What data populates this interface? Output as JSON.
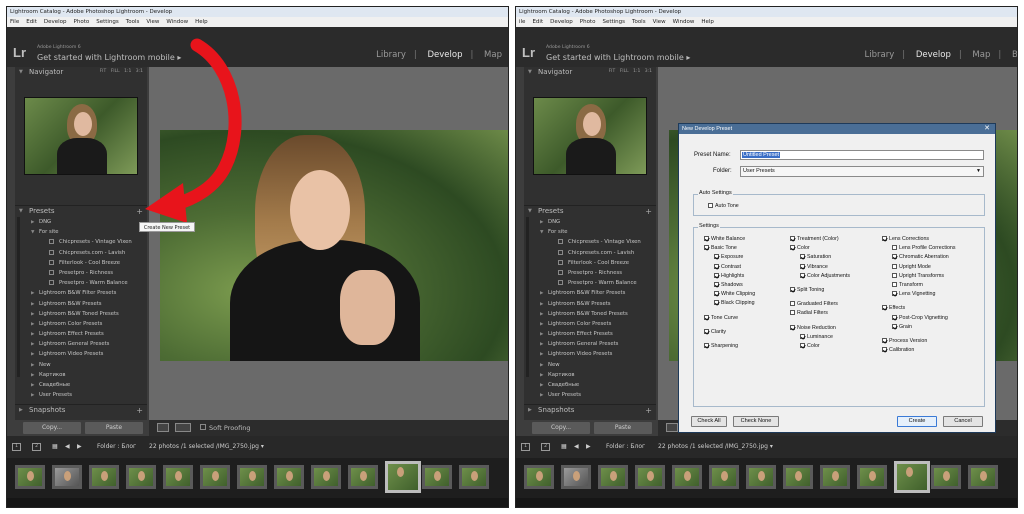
{
  "window": {
    "title": "Lightroom Catalog - Adobe Photoshop Lightroom - Develop",
    "menu": [
      "File",
      "Edit",
      "Develop",
      "Photo",
      "Settings",
      "Tools",
      "View",
      "Window",
      "Help"
    ],
    "menu_right": [
      "ile",
      "Edit",
      "Develop",
      "Photo",
      "Settings",
      "Tools",
      "View",
      "Window",
      "Help"
    ]
  },
  "topbar": {
    "logo": "Lr",
    "version": "Adobe Lightroom 6",
    "mobile": "Get started with Lightroom mobile ▸",
    "modules_left": [
      "Library",
      "Develop",
      "Map"
    ],
    "modules_right": [
      "Library",
      "Develop",
      "Map",
      "Bo"
    ]
  },
  "navigator": {
    "title": "Navigator",
    "options": [
      "FIT",
      "FILL",
      "1:1",
      "3:1"
    ]
  },
  "presets": {
    "title": "Presets",
    "items": [
      {
        "label": "DNG",
        "level": 0,
        "arrow": "▶"
      },
      {
        "label": "For site",
        "level": 0,
        "arrow": "▼"
      },
      {
        "label": "Chicpresets - Vintage Vixen",
        "level": 2
      },
      {
        "label": "Chicpresets.com - Lavish",
        "level": 2
      },
      {
        "label": "Filterlook - Cool Breeze",
        "level": 2
      },
      {
        "label": "Presetpro - Richness",
        "level": 2
      },
      {
        "label": "Presetpro - Warm Balance",
        "level": 2
      },
      {
        "label": "Lightroom B&W Filter Presets",
        "level": 0,
        "arrow": "▶"
      },
      {
        "label": "Lightroom B&W Presets",
        "level": 0,
        "arrow": "▶"
      },
      {
        "label": "Lightroom B&W Toned Presets",
        "level": 0,
        "arrow": "▶"
      },
      {
        "label": "Lightroom Color Presets",
        "level": 0,
        "arrow": "▶"
      },
      {
        "label": "Lightroom Effect Presets",
        "level": 0,
        "arrow": "▶"
      },
      {
        "label": "Lightroom General Presets",
        "level": 0,
        "arrow": "▶"
      },
      {
        "label": "Lightroom Video Presets",
        "level": 0,
        "arrow": "▶"
      },
      {
        "label": "New",
        "level": 0,
        "arrow": "▶"
      },
      {
        "label": "Картиков",
        "level": 0,
        "arrow": "▶"
      },
      {
        "label": "Свадебные",
        "level": 0,
        "arrow": "▶"
      },
      {
        "label": "User Presets",
        "level": 0,
        "arrow": "▶"
      }
    ]
  },
  "snapshots": {
    "title": "Snapshots"
  },
  "buttons": {
    "copy": "Copy...",
    "paste": "Paste"
  },
  "toolstrip": {
    "soft_proofing": "Soft Proofing"
  },
  "filmbar": {
    "screen1": "1",
    "screen2": "2",
    "folder": "Folder : Блог",
    "photos": "22 photos /1 selected /IMG_2750.jpg ▾"
  },
  "tooltip": "Create New Preset",
  "dialog": {
    "title": "New Develop Preset",
    "close": "✕",
    "preset_name_label": "Preset Name:",
    "preset_name_value": "Untitled Preset",
    "folder_label": "Folder:",
    "folder_value": "User Presets",
    "auto_settings_label": "Auto Settings",
    "auto_tone": "Auto Tone",
    "settings_label": "Settings",
    "col1": [
      {
        "label": "White Balance",
        "on": true,
        "indent": 0
      },
      {
        "label": "Basic Tone",
        "on": true,
        "indent": 0
      },
      {
        "label": "Exposure",
        "on": true,
        "indent": 1
      },
      {
        "label": "Contrast",
        "on": true,
        "indent": 1
      },
      {
        "label": "Highlights",
        "on": true,
        "indent": 1
      },
      {
        "label": "Shadows",
        "on": true,
        "indent": 1
      },
      {
        "label": "White Clipping",
        "on": true,
        "indent": 1
      },
      {
        "label": "Black Clipping",
        "on": true,
        "indent": 1
      },
      {
        "label": "Tone Curve",
        "on": true,
        "indent": 0
      },
      {
        "label": "Clarity",
        "on": true,
        "indent": 0
      },
      {
        "label": "Sharpening",
        "on": true,
        "indent": 0
      }
    ],
    "col2": [
      {
        "label": "Treatment (Color)",
        "on": true,
        "indent": 0
      },
      {
        "label": "Color",
        "on": true,
        "indent": 0
      },
      {
        "label": "Saturation",
        "on": true,
        "indent": 1
      },
      {
        "label": "Vibrance",
        "on": true,
        "indent": 1
      },
      {
        "label": "Color Adjustments",
        "on": true,
        "indent": 1
      },
      {
        "label": "Split Toning",
        "on": true,
        "indent": 0
      },
      {
        "label": "Graduated Filters",
        "on": false,
        "indent": 0
      },
      {
        "label": "Radial Filters",
        "on": false,
        "indent": 0
      },
      {
        "label": "Noise Reduction",
        "on": true,
        "indent": 0
      },
      {
        "label": "Luminance",
        "on": true,
        "indent": 1
      },
      {
        "label": "Color",
        "on": true,
        "indent": 1
      }
    ],
    "col3": [
      {
        "label": "Lens Corrections",
        "on": true,
        "indent": 0
      },
      {
        "label": "Lens Profile Corrections",
        "on": false,
        "indent": 1
      },
      {
        "label": "Chromatic Aberration",
        "on": true,
        "indent": 1
      },
      {
        "label": "Upright Mode",
        "on": false,
        "indent": 1
      },
      {
        "label": "Upright Transforms",
        "on": false,
        "indent": 1
      },
      {
        "label": "Transform",
        "on": false,
        "indent": 1
      },
      {
        "label": "Lens Vignetting",
        "on": true,
        "indent": 1
      },
      {
        "label": "Effects",
        "on": true,
        "indent": 0
      },
      {
        "label": "Post-Crop Vignetting",
        "on": true,
        "indent": 1
      },
      {
        "label": "Grain",
        "on": true,
        "indent": 1
      },
      {
        "label": "Process Version",
        "on": true,
        "indent": 0
      },
      {
        "label": "Calibration",
        "on": true,
        "indent": 0
      }
    ],
    "check_all": "Check All",
    "check_none": "Check None",
    "create": "Create",
    "cancel": "Cancel"
  },
  "colors": {
    "arrow": "#e8141b",
    "dialog_title": "#4a6e96",
    "selection": "#3a6ec6"
  }
}
